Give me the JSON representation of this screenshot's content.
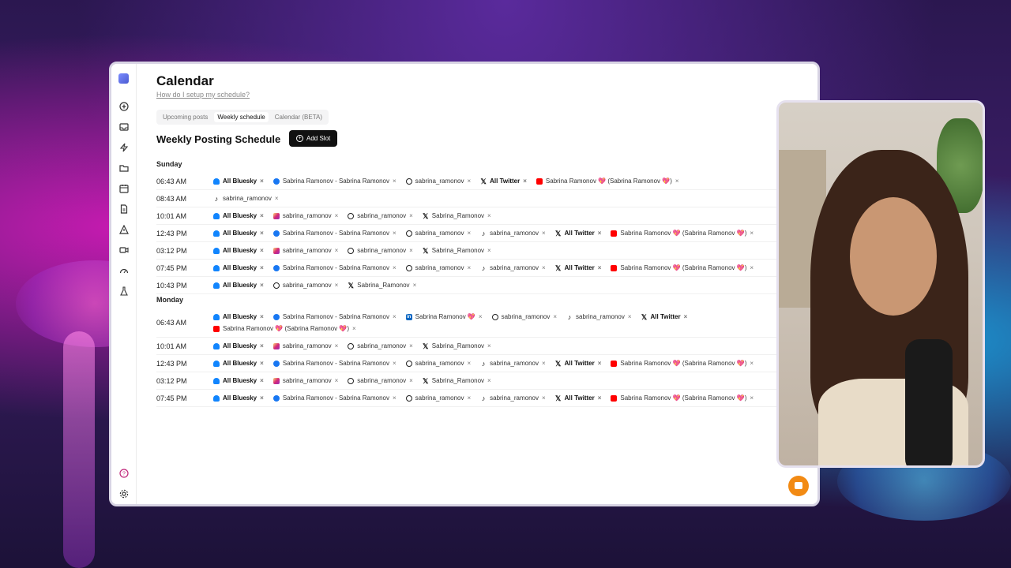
{
  "page": {
    "title": "Calendar",
    "help_link": "How do I setup my schedule?"
  },
  "tabs": [
    {
      "label": "Upcoming posts",
      "active": false
    },
    {
      "label": "Weekly schedule",
      "active": true
    },
    {
      "label": "Calendar (BETA)",
      "active": false
    }
  ],
  "section": {
    "title": "Weekly Posting Schedule",
    "add_slot_label": "Add Slot"
  },
  "sidebar_icons": [
    "plus-circle-icon",
    "inbox-icon",
    "lightning-icon",
    "folder-icon",
    "calendar-icon",
    "document-icon",
    "warning-icon",
    "video-icon",
    "gauge-icon",
    "flask-icon",
    "help-icon",
    "settings-icon"
  ],
  "days": [
    {
      "name": "Sunday",
      "slots": [
        {
          "time": "06:43 AM",
          "chips": [
            {
              "icon": "bluesky",
              "label": "All Bluesky",
              "bold": true
            },
            {
              "icon": "facebook",
              "label": "Sabrina Ramonov - Sabrina Ramonov"
            },
            {
              "icon": "threads",
              "label": "sabrina_ramonov"
            },
            {
              "icon": "x",
              "label": "All Twitter",
              "bold": true
            },
            {
              "icon": "youtube",
              "label": "Sabrina Ramonov 💖 (Sabrina Ramonov 💖)"
            }
          ]
        },
        {
          "time": "08:43 AM",
          "chips": [
            {
              "icon": "tiktok",
              "label": "sabrina_ramonov"
            }
          ]
        },
        {
          "time": "10:01 AM",
          "chips": [
            {
              "icon": "bluesky",
              "label": "All Bluesky",
              "bold": true
            },
            {
              "icon": "instagram",
              "label": "sabrina_ramonov"
            },
            {
              "icon": "threads",
              "label": "sabrina_ramonov"
            },
            {
              "icon": "x",
              "label": "Sabrina_Ramonov"
            }
          ]
        },
        {
          "time": "12:43 PM",
          "chips": [
            {
              "icon": "bluesky",
              "label": "All Bluesky",
              "bold": true
            },
            {
              "icon": "facebook",
              "label": "Sabrina Ramonov - Sabrina Ramonov"
            },
            {
              "icon": "threads",
              "label": "sabrina_ramonov"
            },
            {
              "icon": "tiktok",
              "label": "sabrina_ramonov"
            },
            {
              "icon": "x",
              "label": "All Twitter",
              "bold": true
            },
            {
              "icon": "youtube",
              "label": "Sabrina Ramonov 💖 (Sabrina Ramonov 💖)"
            }
          ]
        },
        {
          "time": "03:12 PM",
          "chips": [
            {
              "icon": "bluesky",
              "label": "All Bluesky",
              "bold": true
            },
            {
              "icon": "instagram",
              "label": "sabrina_ramonov"
            },
            {
              "icon": "threads",
              "label": "sabrina_ramonov"
            },
            {
              "icon": "x",
              "label": "Sabrina_Ramonov"
            }
          ]
        },
        {
          "time": "07:45 PM",
          "chips": [
            {
              "icon": "bluesky",
              "label": "All Bluesky",
              "bold": true
            },
            {
              "icon": "facebook",
              "label": "Sabrina Ramonov - Sabrina Ramonov"
            },
            {
              "icon": "threads",
              "label": "sabrina_ramonov"
            },
            {
              "icon": "tiktok",
              "label": "sabrina_ramonov"
            },
            {
              "icon": "x",
              "label": "All Twitter",
              "bold": true
            },
            {
              "icon": "youtube",
              "label": "Sabrina Ramonov 💖 (Sabrina Ramonov 💖)"
            }
          ]
        },
        {
          "time": "10:43 PM",
          "chips": [
            {
              "icon": "bluesky",
              "label": "All Bluesky",
              "bold": true
            },
            {
              "icon": "threads",
              "label": "sabrina_ramonov"
            },
            {
              "icon": "x",
              "label": "Sabrina_Ramonov"
            }
          ]
        }
      ]
    },
    {
      "name": "Monday",
      "slots": [
        {
          "time": "06:43 AM",
          "chips": [
            {
              "icon": "bluesky",
              "label": "All Bluesky",
              "bold": true
            },
            {
              "icon": "facebook",
              "label": "Sabrina Ramonov - Sabrina Ramonov"
            },
            {
              "icon": "linkedin",
              "label": "Sabrina Ramonov 💖"
            },
            {
              "icon": "threads",
              "label": "sabrina_ramonov"
            },
            {
              "icon": "tiktok",
              "label": "sabrina_ramonov"
            },
            {
              "icon": "x",
              "label": "All Twitter",
              "bold": true
            },
            {
              "icon": "youtube",
              "label": "Sabrina Ramonov 💖 (Sabrina Ramonov 💖)"
            }
          ]
        },
        {
          "time": "10:01 AM",
          "chips": [
            {
              "icon": "bluesky",
              "label": "All Bluesky",
              "bold": true
            },
            {
              "icon": "instagram",
              "label": "sabrina_ramonov"
            },
            {
              "icon": "threads",
              "label": "sabrina_ramonov"
            },
            {
              "icon": "x",
              "label": "Sabrina_Ramonov"
            }
          ]
        },
        {
          "time": "12:43 PM",
          "chips": [
            {
              "icon": "bluesky",
              "label": "All Bluesky",
              "bold": true
            },
            {
              "icon": "facebook",
              "label": "Sabrina Ramonov - Sabrina Ramonov"
            },
            {
              "icon": "threads",
              "label": "sabrina_ramonov"
            },
            {
              "icon": "tiktok",
              "label": "sabrina_ramonov"
            },
            {
              "icon": "x",
              "label": "All Twitter",
              "bold": true
            },
            {
              "icon": "youtube",
              "label": "Sabrina Ramonov 💖 (Sabrina Ramonov 💖)"
            }
          ]
        },
        {
          "time": "03:12 PM",
          "chips": [
            {
              "icon": "bluesky",
              "label": "All Bluesky",
              "bold": true
            },
            {
              "icon": "instagram",
              "label": "sabrina_ramonov"
            },
            {
              "icon": "threads",
              "label": "sabrina_ramonov"
            },
            {
              "icon": "x",
              "label": "Sabrina_Ramonov"
            }
          ]
        },
        {
          "time": "07:45 PM",
          "chips": [
            {
              "icon": "bluesky",
              "label": "All Bluesky",
              "bold": true
            },
            {
              "icon": "facebook",
              "label": "Sabrina Ramonov - Sabrina Ramonov"
            },
            {
              "icon": "threads",
              "label": "sabrina_ramonov"
            },
            {
              "icon": "tiktok",
              "label": "sabrina_ramonov"
            },
            {
              "icon": "x",
              "label": "All Twitter",
              "bold": true
            },
            {
              "icon": "youtube",
              "label": "Sabrina Ramonov 💖 (Sabrina Ramonov 💖)"
            }
          ]
        }
      ]
    }
  ],
  "colors": {
    "accent_button": "#111111",
    "chat_button": "#f28a13",
    "bluesky": "#1185fe",
    "facebook": "#1877f2",
    "youtube": "#ff0000",
    "linkedin": "#0a66c2"
  }
}
